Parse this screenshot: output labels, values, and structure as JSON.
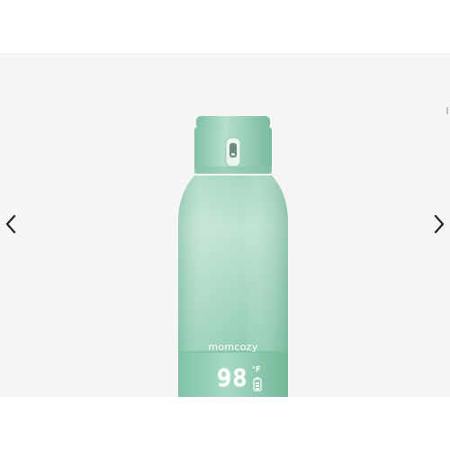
{
  "gallery": {
    "prev_icon": "chevron-left-icon",
    "next_icon": "chevron-right-icon"
  },
  "product": {
    "brand": "momcozy",
    "display_temperature": "98",
    "display_unit": "°F",
    "colors": {
      "body_top": "#cfe7dd",
      "body_bottom": "#8cc9ad",
      "cap": "#a9d6c1",
      "display_text": "#ffffff"
    }
  }
}
